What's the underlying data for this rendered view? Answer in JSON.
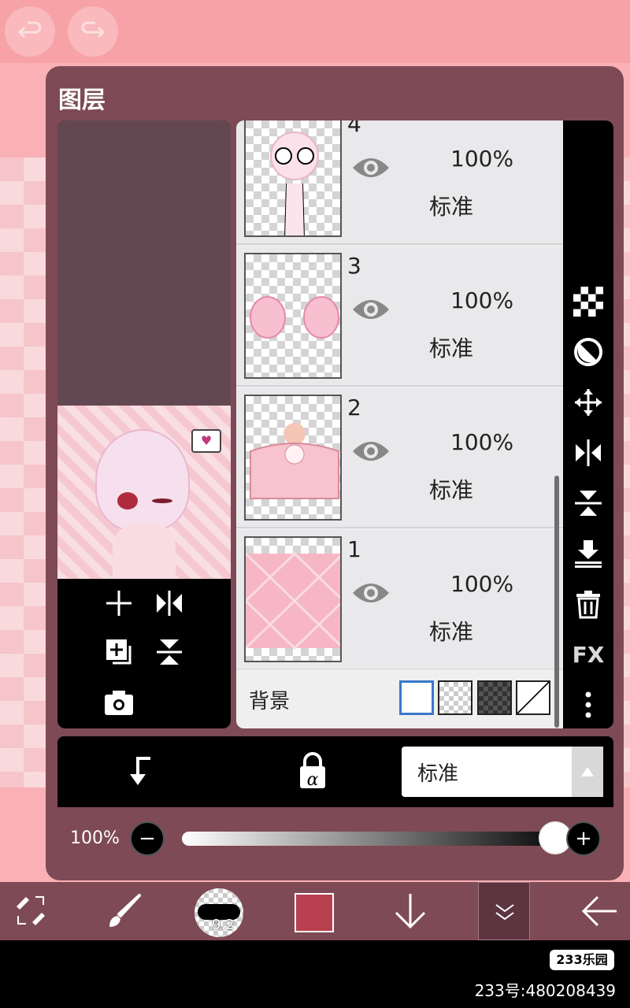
{
  "app": {
    "panel_title": "图层",
    "blend_mode": "标准",
    "opacity_label": "100%",
    "opacity_value": 1.0,
    "background_label": "背景"
  },
  "layers": [
    {
      "number": "4",
      "opacity": "100%",
      "blend": "标准",
      "visible": true
    },
    {
      "number": "3",
      "opacity": "100%",
      "blend": "标准",
      "visible": true
    },
    {
      "number": "2",
      "opacity": "100%",
      "blend": "标准",
      "visible": true
    },
    {
      "number": "1",
      "opacity": "100%",
      "blend": "标准",
      "visible": true
    }
  ],
  "side_tools": [
    "checker-icon",
    "half-circle-icon",
    "move-icon",
    "flip-horizontal-icon",
    "flip-vertical-icon",
    "merge-down-icon",
    "trash-icon",
    "FX",
    "more-icon"
  ],
  "side_fx_label": "FX",
  "brush": {
    "size_label": "9.2"
  },
  "colors": {
    "current": "#b8404f",
    "accent": "#7e4a55",
    "canvas_pink": "#f7a2a7"
  },
  "preview": {
    "speech_icon": "♥"
  },
  "watermark": {
    "logo": "233乐园",
    "id_text": "233号:480208439"
  }
}
